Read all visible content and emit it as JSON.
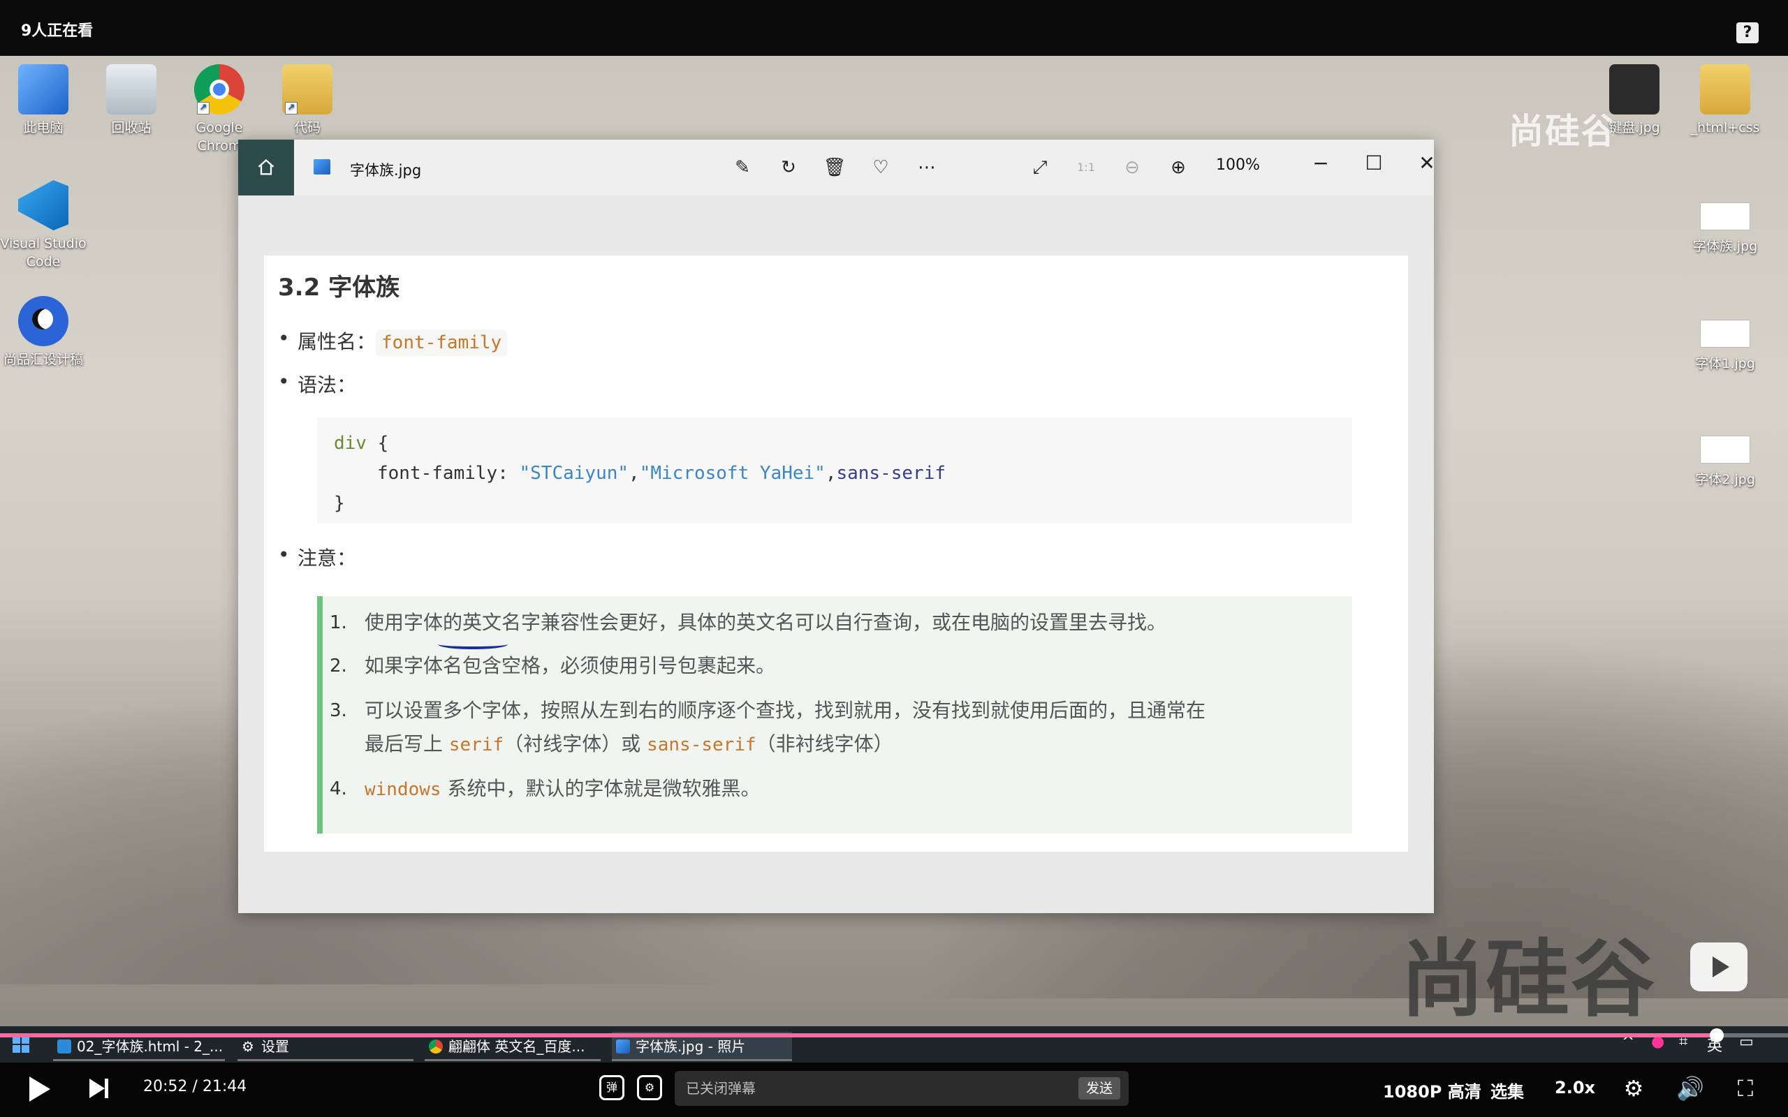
{
  "player": {
    "watching": "9人正在看",
    "help": "?",
    "current_time": "20:52",
    "time_separator": "/",
    "duration": "21:44",
    "progress": 0.96,
    "danmaku_placeholder": "已关闭弹幕",
    "send_label": "发送",
    "quality": "1080P 高清",
    "episodes": "选集",
    "speed": "2.0x"
  },
  "desktop": {
    "icons_left": [
      {
        "label": "此电脑",
        "icon": "computer-icon"
      },
      {
        "label": "回收站",
        "icon": "recycle-bin-icon"
      },
      {
        "label": "Google Chrom",
        "icon": "chrome-icon"
      },
      {
        "label": "代码",
        "icon": "folder-icon"
      },
      {
        "label": "Visual Studio Code",
        "icon": "vscode-icon"
      },
      {
        "label": "尚品汇设计稿",
        "icon": "app-icon"
      }
    ],
    "icons_right": [
      {
        "label": "键盘.jpg",
        "icon": "image-icon"
      },
      {
        "label": "_html+css",
        "icon": "folder-icon"
      },
      {
        "label": "字体族.jpg",
        "icon": "image-icon"
      },
      {
        "label": "字体1.jpg",
        "icon": "image-icon"
      },
      {
        "label": "字体2.jpg",
        "icon": "image-icon"
      }
    ],
    "watermark_top": "尚硅谷",
    "watermark_bottom": "尚硅谷"
  },
  "window": {
    "file_name": "字体族.jpg",
    "zoom": "100%",
    "toolbar": [
      "edit-icon",
      "rotate-icon",
      "delete-icon",
      "favorite-icon",
      "more-icon"
    ]
  },
  "doc": {
    "heading": "3.2 字体族",
    "prop_label": "属性名：",
    "prop_code": "font-family",
    "syntax_label": "语法：",
    "code": {
      "line1_kw": "div",
      "line1_brace": " {",
      "line2_prop": "font-family",
      "line2_colon": ": ",
      "line2_str1": "\"STCaiyun\"",
      "line2_comma1": ",",
      "line2_str2": "\"Microsoft YaHei\"",
      "line2_comma2": ",",
      "line2_val": "sans-serif",
      "line3": "}"
    },
    "note_label": "注意：",
    "notes": [
      {
        "num": "1.",
        "text": "使用字体的英文名字兼容性会更好，具体的英文名可以自行查询，或在电脑的设置里去寻找。"
      },
      {
        "num": "2.",
        "text": "如果字体名包含空格，必须使用引号包裹起来。"
      },
      {
        "num": "3.",
        "line1": "可以设置多个字体，按照从左到右的顺序逐个查找，找到就用，没有找到就使用后面的，且通常在",
        "line2_a": "最后写上 ",
        "serif": "serif",
        "line2_b": "（衬线字体）或 ",
        "sans": "sans-serif",
        "line2_c": "（非衬线字体）"
      },
      {
        "num": "4.",
        "code": "windows",
        "text": " 系统中，默认的字体就是微软雅黑。"
      }
    ]
  },
  "taskbar": {
    "tasks": [
      {
        "label": "02_字体族.html - 2_..."
      },
      {
        "label": "设置"
      },
      {
        "label": "翩翩体 英文名_百度..."
      },
      {
        "label": "字体族.jpg - 照片"
      }
    ],
    "ime": "英"
  }
}
